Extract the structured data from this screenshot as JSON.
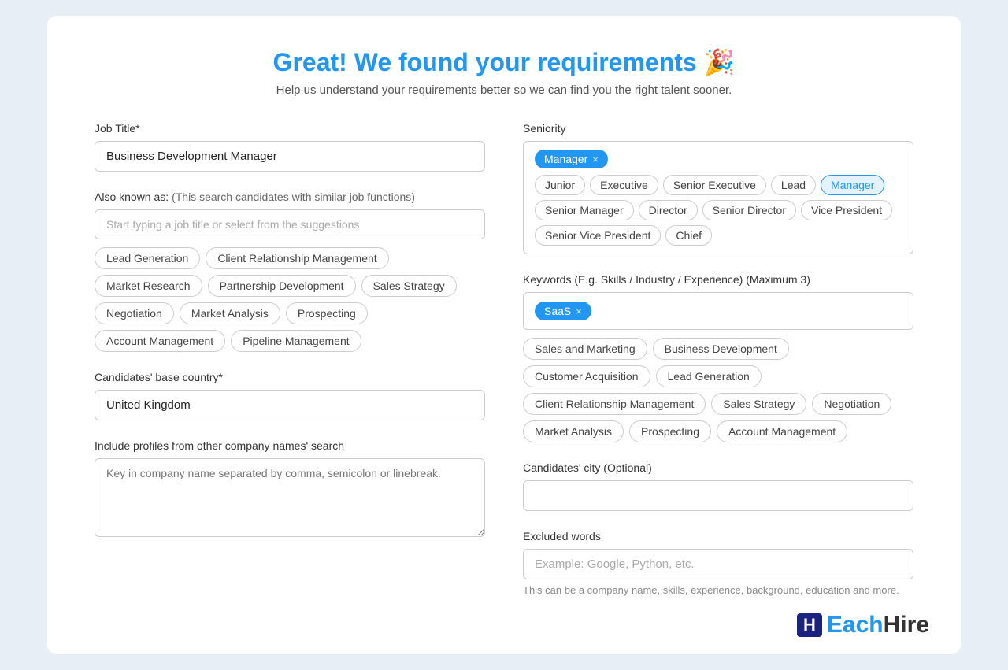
{
  "header": {
    "title": "Great! We found your requirements 🎉",
    "subtitle": "Help us understand your requirements better so we can find you the right talent sooner."
  },
  "job_title_label": "Job Title*",
  "job_title_value": "Business Development Manager",
  "also_known_label": "Also known as:",
  "also_known_subtitle": "(This search candidates with similar job functions)",
  "also_known_placeholder": "Start typing a job title or select from the suggestions",
  "also_known_suggestions": [
    "Lead Generation",
    "Client Relationship Management",
    "Market Research",
    "Partnership Development",
    "Sales Strategy",
    "Negotiation",
    "Market Analysis",
    "Prospecting",
    "Account Management",
    "Pipeline Management"
  ],
  "seniority_label": "Seniority",
  "seniority_selected": [
    "Manager"
  ],
  "seniority_options": [
    "Junior",
    "Executive",
    "Senior Executive",
    "Lead",
    "Manager",
    "Senior Manager",
    "Director",
    "Senior Director",
    "Vice President",
    "Senior Vice President",
    "Chief"
  ],
  "keywords_label": "Keywords (E.g. Skills / Industry / Experience) (Maximum 3)",
  "keywords_selected": [
    "SaaS"
  ],
  "keywords_suggestions": [
    "Sales and Marketing",
    "Business Development",
    "Customer Acquisition",
    "Lead Generation",
    "Client Relationship Management",
    "Sales Strategy",
    "Negotiation",
    "Market Analysis",
    "Prospecting",
    "Account Management"
  ],
  "base_country_label": "Candidates' base country*",
  "base_country_value": "United Kingdom",
  "city_label": "Candidates' city (Optional)",
  "city_placeholder": "",
  "include_profiles_label": "Include profiles from other company names' search",
  "include_profiles_placeholder": "Key in company name separated by comma, semicolon or linebreak.",
  "excluded_words_label": "Excluded words",
  "excluded_words_placeholder": "Example: Google, Python, etc.",
  "excluded_words_hint": "This can be a company name, skills, experience, background, education and more.",
  "logo": {
    "icon": "H",
    "text_blue": "Each",
    "text_dark": "Hire"
  }
}
